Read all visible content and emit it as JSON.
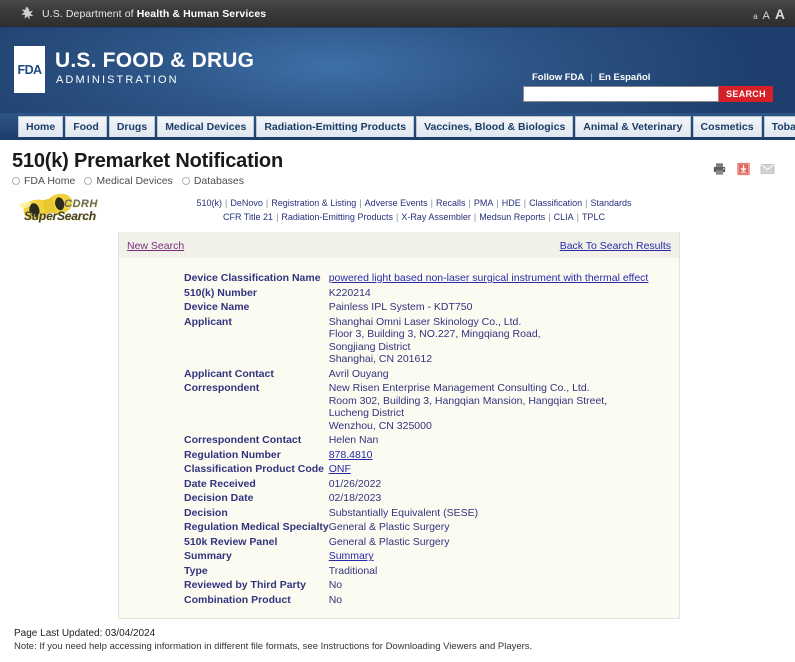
{
  "hhs_bar": {
    "logo_icon": "hhs-eagle-icon",
    "text_prefix": "U.S. Department of ",
    "text_bold": "Health & Human Services",
    "font_sizes": [
      "a",
      "A",
      "A"
    ]
  },
  "masthead": {
    "logo_mark": "FDA",
    "brand_line1": "U.S. FOOD & DRUG",
    "brand_line2": "ADMINISTRATION",
    "utility": {
      "follow": "Follow FDA",
      "separator": "|",
      "espanol": "En Español"
    },
    "search": {
      "value": "",
      "placeholder": "",
      "button_label": "SEARCH"
    }
  },
  "nav": {
    "items": [
      {
        "label": "Home",
        "name": "nav-home"
      },
      {
        "label": "Food",
        "name": "nav-food"
      },
      {
        "label": "Drugs",
        "name": "nav-drugs"
      },
      {
        "label": "Medical Devices",
        "name": "nav-medical-devices"
      },
      {
        "label": "Radiation-Emitting Products",
        "name": "nav-radiation-emitting-products"
      },
      {
        "label": "Vaccines, Blood & Biologics",
        "name": "nav-vaccines-blood-biologics"
      },
      {
        "label": "Animal & Veterinary",
        "name": "nav-animal-veterinary"
      },
      {
        "label": "Cosmetics",
        "name": "nav-cosmetics"
      },
      {
        "label": "Tobacco Products",
        "name": "nav-tobacco-products"
      }
    ]
  },
  "page": {
    "title": "510(k) Premarket Notification",
    "breadcrumb": [
      "FDA Home",
      "Medical Devices",
      "Databases"
    ],
    "tools": [
      "print-icon",
      "pdf-icon",
      "email-icon"
    ]
  },
  "supersearch": {
    "line1": "CDRH",
    "line2": "SuperSearch",
    "icon": "binoculars-icon"
  },
  "linkbar": {
    "row1": [
      "510(k)",
      "DeNovo",
      "Registration & Listing",
      "Adverse Events",
      "Recalls",
      "PMA",
      "HDE",
      "Classification",
      "Standards"
    ],
    "row2": [
      "CFR Title 21",
      "Radiation-Emitting Products",
      "X-Ray Assembler",
      "Medsun Reports",
      "CLIA",
      "TPLC"
    ],
    "separator": "|"
  },
  "search_nav": {
    "new_search": "New Search",
    "back_to_results": "Back To Search Results"
  },
  "record": {
    "rows": [
      {
        "label": "Device Classification Name",
        "value": "powered light based non-laser surgical instrument with thermal effect",
        "link": true,
        "name": "device-classification-name"
      },
      {
        "label": "510(k) Number",
        "value": "K220214",
        "link": false,
        "name": "k-number"
      },
      {
        "label": "Device Name",
        "value": "Painless IPL System - KDT750",
        "link": false,
        "name": "device-name"
      },
      {
        "label": "Applicant",
        "value": "Shanghai Omni Laser Skinology Co., Ltd.\nFloor 3, Building 3, NO.227, Mingqiang Road,\nSongjiang District\nShanghai,  CN 201612",
        "link": false,
        "name": "applicant"
      },
      {
        "label": "Applicant Contact",
        "value": "Avril Ouyang",
        "link": false,
        "name": "applicant-contact"
      },
      {
        "label": "Correspondent",
        "value": "New Risen Enterprise Management Consulting Co., Ltd.\nRoom 302, Building 3, Hangqian Mansion, Hangqian Street,\nLucheng District\nWenzhou,  CN 325000",
        "link": false,
        "name": "correspondent"
      },
      {
        "label": "Correspondent Contact",
        "value": "Helen Nan",
        "link": false,
        "name": "correspondent-contact"
      },
      {
        "label": "Regulation Number",
        "value": "878.4810",
        "link": true,
        "name": "regulation-number"
      },
      {
        "label": "Classification Product Code",
        "value": "ONF",
        "link": true,
        "name": "classification-product-code"
      },
      {
        "label": "Date Received",
        "value": "01/26/2022",
        "link": false,
        "name": "date-received"
      },
      {
        "label": "Decision Date",
        "value": "02/18/2023",
        "link": false,
        "name": "decision-date"
      },
      {
        "label": "Decision",
        "value": "Substantially Equivalent (SESE)",
        "link": false,
        "name": "decision"
      },
      {
        "label": "Regulation Medical Specialty",
        "value": "General & Plastic Surgery",
        "link": false,
        "name": "regulation-medical-specialty"
      },
      {
        "label": "510k Review Panel",
        "value": "General & Plastic Surgery",
        "link": false,
        "name": "review-panel"
      },
      {
        "label": "Summary",
        "value": "Summary",
        "link": true,
        "name": "summary"
      },
      {
        "label": "Type",
        "value": "Traditional",
        "link": false,
        "name": "type"
      },
      {
        "label": "Reviewed by Third Party",
        "value": "No",
        "link": false,
        "name": "reviewed-by-third-party"
      },
      {
        "label": "Combination Product",
        "value": "No",
        "link": false,
        "name": "combination-product"
      }
    ]
  },
  "footer": {
    "page_last_updated": "Page Last Updated: 03/04/2024",
    "disclaimer": "Note: If you need help accessing information in different file formats, see Instructions for Downloading Viewers and Players."
  },
  "colors": {
    "fda_blue": "#1e3f6d",
    "search_red": "#d61f26",
    "link_blue": "#2929a8",
    "visited_purple": "#7b2d7b",
    "content_bg": "#fbfbf2"
  }
}
